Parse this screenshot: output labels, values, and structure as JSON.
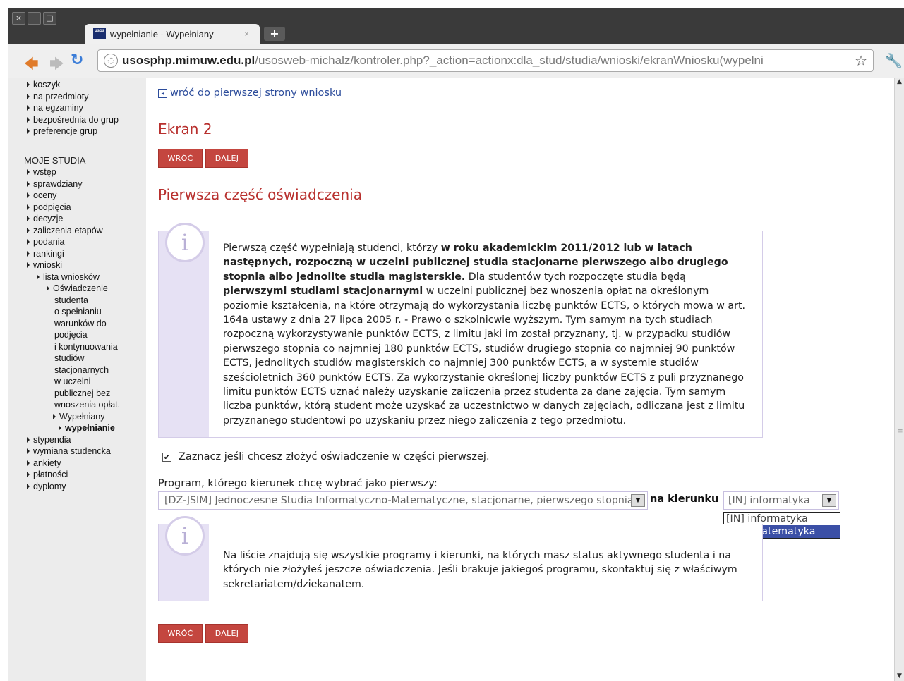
{
  "browser": {
    "tab_title": "wypełnianie - Wypełniany",
    "tab_close": "×",
    "new_tab": "+",
    "favicon_text": "usos",
    "url_host": "usosphp.mimuw.edu.pl",
    "url_path": "/usosweb-michalz/kontroler.php?_action=actionx:dla_stud/studia/wnioski/ekranWniosku(wypelni",
    "win_close": "×",
    "win_min": "−",
    "win_max": "□"
  },
  "sidebar": {
    "top_items": [
      "koszyk",
      "na przedmioty",
      "na egzaminy",
      "bezpośrednia do grup",
      "preferencje grup"
    ],
    "heading": "MOJE STUDIA",
    "items": [
      "wstęp",
      "sprawdziany",
      "oceny",
      "podpięcia",
      "decyzje",
      "zaliczenia etapów",
      "podania",
      "rankingi",
      "wnioski"
    ],
    "lista": "lista wniosków",
    "oswiadczenie_lines": [
      "Oświadczenie",
      "studenta",
      "o spełnianiu",
      "warunków do",
      "podjęcia",
      "i kontynuowania",
      "studiów",
      "stacjonarnych",
      "w uczelni",
      "publicznej bez",
      "wnoszenia opłat."
    ],
    "wypelniany": "Wypełniany",
    "wypelnianie": "wypełnianie",
    "bottom_items": [
      "stypendia",
      "wymiana studencka",
      "ankiety",
      "płatności",
      "dyplomy"
    ]
  },
  "main": {
    "back_link": "wróć do pierwszej strony wniosku",
    "screen_title": "Ekran 2",
    "btn_back": "WRÓĆ",
    "btn_next": "DALEJ",
    "section_title": "Pierwsza część oświadczenia",
    "info_icon": "i",
    "info1": {
      "p1": "Pierwszą część wypełniają studenci, którzy ",
      "b1": "w roku akademickim 2011/2012 lub w latach następnych, rozpoczną w uczelni publicznej studia stacjonarne pierwszego albo drugiego stopnia albo jednolite studia magisterskie.",
      "p2": " Dla studentów tych rozpoczęte studia będą ",
      "b2": "pierwszymi studiami stacjonarnymi",
      "p3": " w uczelni publicznej bez wnoszenia opłat na określonym poziomie kształcenia, na które otrzymają do wykorzystania liczbę punktów ECTS, o których mowa w art. 164a ustawy z dnia 27 lipca 2005 r. - Prawo o szkolnicwie wyższym. Tym samym na tych studiach rozpoczną wykorzystywanie punktów ECTS, z limitu jaki im został przyznany, tj. w przypadku studiów pierwszego stopnia co najmniej 180 punktów ECTS, studiów drugiego stopnia co najmniej 90 punktów ECTS, jednolitych studiów magisterskich co najmniej 300 punktów ECTS, a w systemie studiów sześcioletnich 360 punktów ECTS. Za wykorzystanie określonej liczby punktów ECTS z puli przyznanego limitu punktów ECTS uznać należy uzyskanie zaliczenia przez studenta za dane zajęcia. Tym samym liczba punktów, którą student może uzyskać za uczestnictwo w danych zajęciach, odliczana jest z limitu przyznanego studentowi po uzyskaniu przez niego zaliczenia z tego przedmiotu."
    },
    "checkbox_mark": "✔",
    "checkbox_label": "Zaznacz jeśli chcesz złożyć oświadczenie w części pierwszej.",
    "program_label": "Program, którego kierunek chcę wybrać jako pierwszy:",
    "program_value": "[DZ-JSIM] Jednoczesne Studia Informatyczno-Matematyczne, stacjonarne, pierwszego stopnia",
    "na_kierunku": "na kierunku",
    "kierunek_value": "[IN] informatyka",
    "kierunek_options": [
      "[IN] informatyka",
      "[MT] matematyka"
    ],
    "info2": "Na liście znajdują się wszystkie programy i kierunki, na których masz status aktywnego studenta i na których nie złożyłeś jeszcze oświadczenia. Jeśli brakuje jakiegoś programu, skontaktuj się z właściwym sekretariatem/dziekanatem."
  }
}
